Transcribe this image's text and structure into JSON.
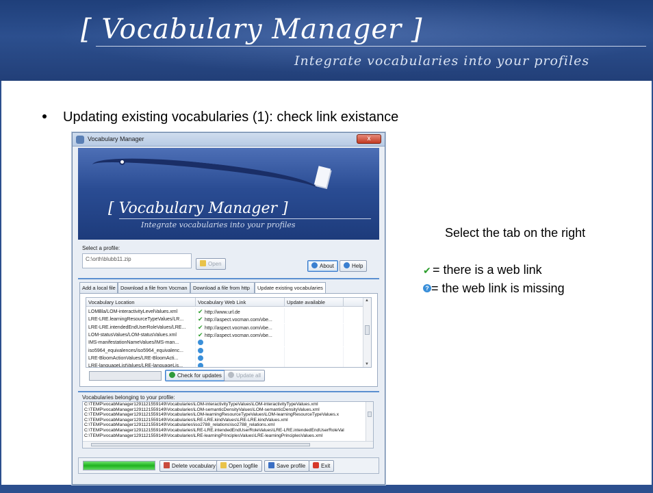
{
  "slide": {
    "brand_title": "[ Vocabulary Manager ]",
    "brand_subtitle": "Integrate vocabularies into your profiles",
    "bullet": "Updating existing vocabularies (1): check link existance",
    "side_note": "Select the tab on the right",
    "legend": [
      {
        "icon": "check-icon",
        "text": "= there is a web link"
      },
      {
        "icon": "info-icon",
        "text": "= the web link is missing"
      }
    ],
    "colors": {
      "header": "#2c4f8e",
      "link_ok": "#2a9d2a",
      "link_missing": "#3a8fd9"
    }
  },
  "window": {
    "title": "Vocabulary Manager",
    "close_glyph": "x",
    "banner_title": "[ Vocabulary Manager ]",
    "banner_subtitle": "Integrate vocabularies into your profiles",
    "profile_label": "Select a profile:",
    "profile_value": "C:\\orth\\blubb11.zip",
    "open_button": "Open",
    "about_button": "About",
    "help_button": "Help",
    "tabs": [
      "Add a local file",
      "Download a file from Vocman",
      "Download a file from http",
      "Update existing vocabularies"
    ],
    "active_tab": "Update existing vocabularies",
    "grid": {
      "columns": [
        "Vocabulary Location",
        "Vocabulary Web Link",
        "Update available"
      ],
      "rows": [
        {
          "location": "LOMBla/LOM-interactivityLevelValues.xml",
          "has_link": true,
          "link": "http://www.url.de",
          "update": ""
        },
        {
          "location": "LRE-LRE.learningResourceTypeValues/LR...",
          "has_link": true,
          "link": "http://aspect.vocman.com/vbe...",
          "update": ""
        },
        {
          "location": "LRE-LRE.intendedEndUserRoleValues/LRE...",
          "has_link": true,
          "link": "http://aspect.vocman.com/vbe...",
          "update": ""
        },
        {
          "location": "LOM-statusValues/LOM-statusValues.xml",
          "has_link": true,
          "link": "http://aspect.vocman.com/vbe...",
          "update": ""
        },
        {
          "location": "IMS-manifestationNameValues/IMS-man...",
          "has_link": false,
          "link": "",
          "update": ""
        },
        {
          "location": "iso5964_equivalences/iso5964_equivalenc...",
          "has_link": false,
          "link": "",
          "update": ""
        },
        {
          "location": "LRE-BloomActionValues/LRE-BloomActi...",
          "has_link": false,
          "link": "",
          "update": ""
        },
        {
          "location": "LRE-languageListValues/LRE-languageLis...",
          "has_link": false,
          "link": "",
          "update": ""
        }
      ]
    },
    "check_updates_button": "Check for updates",
    "update_all_button": "Update all",
    "check_progress": 0,
    "belonging_label": "Vocabularies belonging to your profile:",
    "paths": [
      "C:\\TEMP\\vocabManager1291121559149\\Vocabularies\\LOM-interactivityTypeValues\\LOM-interactivityTypeValues.xml",
      "C:\\TEMP\\vocabManager1291121559149\\Vocabularies\\LOM-semanticDensityValues\\LOM-semanticDensityValues.xml",
      "C:\\TEMP\\vocabManager1291121559149\\Vocabularies\\LOM-learningResourceTypeValues\\LOM-learningResourceTypeValues.x",
      "C:\\TEMP\\vocabManager1291121559149\\Vocabularies\\LRE-LRE.kindValues\\LRE-LRE.kindValues.xml",
      "C:\\TEMP\\vocabManager1291121559149\\Vocabularies\\iso2788_relations\\iso2788_relations.xml",
      "C:\\TEMP\\vocabManager1291121559149\\Vocabularies\\LRE-LRE.intendedEndUserRoleValues\\LRE-LRE.intendedEndUserRoleVal",
      "C:\\TEMP\\vocabManager1291121559149\\Vocabularies\\LRE-learningPrinciplesValues\\LRE-learningPrinciplesValues.xml"
    ],
    "hscroll_glyph": "III",
    "bottom_progress": 1.0,
    "delete_button": "Delete vocabulary",
    "open_log_button": "Open logfile",
    "save_profile_button": "Save profile",
    "exit_button": "Exit"
  }
}
